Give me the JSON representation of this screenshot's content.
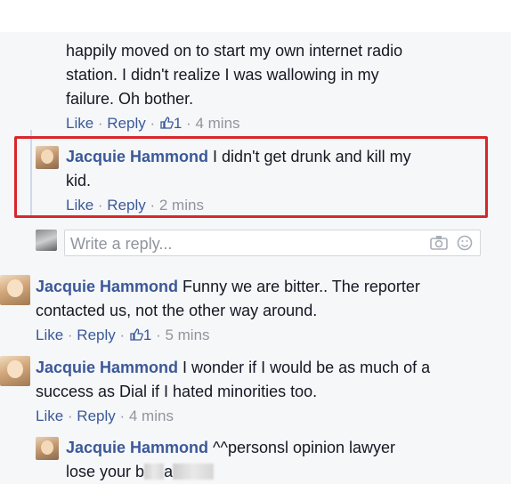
{
  "comments": [
    {
      "text_lines": [
        "happily moved on to start my own internet radio",
        "station. I didn't realize I was wallowing in my",
        "failure. Oh bother."
      ],
      "like": "Like",
      "reply": "Reply",
      "likes_count": "1",
      "time": "4 mins"
    },
    {
      "author": "Jacquie Hammond",
      "text_line1": " I didn't get drunk and kill my",
      "text_line2": "kid.",
      "like": "Like",
      "reply": "Reply",
      "time": "2 mins"
    },
    {
      "author": "Jacquie Hammond",
      "text_line1": " Funny we are bitter.. The reporter",
      "text_line2": "contacted us, not the other way around.",
      "like": "Like",
      "reply": "Reply",
      "likes_count": "1",
      "time": "5 mins"
    },
    {
      "author": "Jacquie Hammond",
      "text_line1": " I wonder if I would be as much of a",
      "text_line2": "success as Dial if I hated minorities too.",
      "like": "Like",
      "reply": "Reply",
      "time": "4 mins"
    },
    {
      "author": "Jacquie Hammond",
      "text_line1": " ^^personsl opinion lawyer",
      "text_line2_a": "lose your b",
      "text_line2_b": "a"
    }
  ],
  "reply_box": {
    "placeholder": "Write a reply..."
  },
  "colors": {
    "link": "#3b5998",
    "highlight": "#d9262b",
    "meta_grey": "#90949c"
  },
  "icons": [
    "camera-icon",
    "emoji-icon",
    "thumbs-up-icon"
  ]
}
